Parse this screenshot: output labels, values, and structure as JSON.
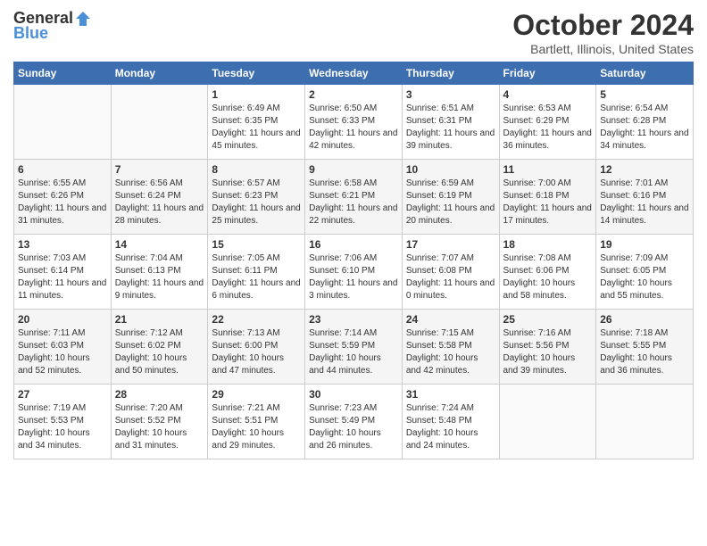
{
  "logo": {
    "general": "General",
    "blue": "Blue"
  },
  "header": {
    "month": "October 2024",
    "location": "Bartlett, Illinois, United States"
  },
  "weekdays": [
    "Sunday",
    "Monday",
    "Tuesday",
    "Wednesday",
    "Thursday",
    "Friday",
    "Saturday"
  ],
  "weeks": [
    [
      {
        "day": "",
        "sunrise": "",
        "sunset": "",
        "daylight": ""
      },
      {
        "day": "",
        "sunrise": "",
        "sunset": "",
        "daylight": ""
      },
      {
        "day": "1",
        "sunrise": "Sunrise: 6:49 AM",
        "sunset": "Sunset: 6:35 PM",
        "daylight": "Daylight: 11 hours and 45 minutes."
      },
      {
        "day": "2",
        "sunrise": "Sunrise: 6:50 AM",
        "sunset": "Sunset: 6:33 PM",
        "daylight": "Daylight: 11 hours and 42 minutes."
      },
      {
        "day": "3",
        "sunrise": "Sunrise: 6:51 AM",
        "sunset": "Sunset: 6:31 PM",
        "daylight": "Daylight: 11 hours and 39 minutes."
      },
      {
        "day": "4",
        "sunrise": "Sunrise: 6:53 AM",
        "sunset": "Sunset: 6:29 PM",
        "daylight": "Daylight: 11 hours and 36 minutes."
      },
      {
        "day": "5",
        "sunrise": "Sunrise: 6:54 AM",
        "sunset": "Sunset: 6:28 PM",
        "daylight": "Daylight: 11 hours and 34 minutes."
      }
    ],
    [
      {
        "day": "6",
        "sunrise": "Sunrise: 6:55 AM",
        "sunset": "Sunset: 6:26 PM",
        "daylight": "Daylight: 11 hours and 31 minutes."
      },
      {
        "day": "7",
        "sunrise": "Sunrise: 6:56 AM",
        "sunset": "Sunset: 6:24 PM",
        "daylight": "Daylight: 11 hours and 28 minutes."
      },
      {
        "day": "8",
        "sunrise": "Sunrise: 6:57 AM",
        "sunset": "Sunset: 6:23 PM",
        "daylight": "Daylight: 11 hours and 25 minutes."
      },
      {
        "day": "9",
        "sunrise": "Sunrise: 6:58 AM",
        "sunset": "Sunset: 6:21 PM",
        "daylight": "Daylight: 11 hours and 22 minutes."
      },
      {
        "day": "10",
        "sunrise": "Sunrise: 6:59 AM",
        "sunset": "Sunset: 6:19 PM",
        "daylight": "Daylight: 11 hours and 20 minutes."
      },
      {
        "day": "11",
        "sunrise": "Sunrise: 7:00 AM",
        "sunset": "Sunset: 6:18 PM",
        "daylight": "Daylight: 11 hours and 17 minutes."
      },
      {
        "day": "12",
        "sunrise": "Sunrise: 7:01 AM",
        "sunset": "Sunset: 6:16 PM",
        "daylight": "Daylight: 11 hours and 14 minutes."
      }
    ],
    [
      {
        "day": "13",
        "sunrise": "Sunrise: 7:03 AM",
        "sunset": "Sunset: 6:14 PM",
        "daylight": "Daylight: 11 hours and 11 minutes."
      },
      {
        "day": "14",
        "sunrise": "Sunrise: 7:04 AM",
        "sunset": "Sunset: 6:13 PM",
        "daylight": "Daylight: 11 hours and 9 minutes."
      },
      {
        "day": "15",
        "sunrise": "Sunrise: 7:05 AM",
        "sunset": "Sunset: 6:11 PM",
        "daylight": "Daylight: 11 hours and 6 minutes."
      },
      {
        "day": "16",
        "sunrise": "Sunrise: 7:06 AM",
        "sunset": "Sunset: 6:10 PM",
        "daylight": "Daylight: 11 hours and 3 minutes."
      },
      {
        "day": "17",
        "sunrise": "Sunrise: 7:07 AM",
        "sunset": "Sunset: 6:08 PM",
        "daylight": "Daylight: 11 hours and 0 minutes."
      },
      {
        "day": "18",
        "sunrise": "Sunrise: 7:08 AM",
        "sunset": "Sunset: 6:06 PM",
        "daylight": "Daylight: 10 hours and 58 minutes."
      },
      {
        "day": "19",
        "sunrise": "Sunrise: 7:09 AM",
        "sunset": "Sunset: 6:05 PM",
        "daylight": "Daylight: 10 hours and 55 minutes."
      }
    ],
    [
      {
        "day": "20",
        "sunrise": "Sunrise: 7:11 AM",
        "sunset": "Sunset: 6:03 PM",
        "daylight": "Daylight: 10 hours and 52 minutes."
      },
      {
        "day": "21",
        "sunrise": "Sunrise: 7:12 AM",
        "sunset": "Sunset: 6:02 PM",
        "daylight": "Daylight: 10 hours and 50 minutes."
      },
      {
        "day": "22",
        "sunrise": "Sunrise: 7:13 AM",
        "sunset": "Sunset: 6:00 PM",
        "daylight": "Daylight: 10 hours and 47 minutes."
      },
      {
        "day": "23",
        "sunrise": "Sunrise: 7:14 AM",
        "sunset": "Sunset: 5:59 PM",
        "daylight": "Daylight: 10 hours and 44 minutes."
      },
      {
        "day": "24",
        "sunrise": "Sunrise: 7:15 AM",
        "sunset": "Sunset: 5:58 PM",
        "daylight": "Daylight: 10 hours and 42 minutes."
      },
      {
        "day": "25",
        "sunrise": "Sunrise: 7:16 AM",
        "sunset": "Sunset: 5:56 PM",
        "daylight": "Daylight: 10 hours and 39 minutes."
      },
      {
        "day": "26",
        "sunrise": "Sunrise: 7:18 AM",
        "sunset": "Sunset: 5:55 PM",
        "daylight": "Daylight: 10 hours and 36 minutes."
      }
    ],
    [
      {
        "day": "27",
        "sunrise": "Sunrise: 7:19 AM",
        "sunset": "Sunset: 5:53 PM",
        "daylight": "Daylight: 10 hours and 34 minutes."
      },
      {
        "day": "28",
        "sunrise": "Sunrise: 7:20 AM",
        "sunset": "Sunset: 5:52 PM",
        "daylight": "Daylight: 10 hours and 31 minutes."
      },
      {
        "day": "29",
        "sunrise": "Sunrise: 7:21 AM",
        "sunset": "Sunset: 5:51 PM",
        "daylight": "Daylight: 10 hours and 29 minutes."
      },
      {
        "day": "30",
        "sunrise": "Sunrise: 7:23 AM",
        "sunset": "Sunset: 5:49 PM",
        "daylight": "Daylight: 10 hours and 26 minutes."
      },
      {
        "day": "31",
        "sunrise": "Sunrise: 7:24 AM",
        "sunset": "Sunset: 5:48 PM",
        "daylight": "Daylight: 10 hours and 24 minutes."
      },
      {
        "day": "",
        "sunrise": "",
        "sunset": "",
        "daylight": ""
      },
      {
        "day": "",
        "sunrise": "",
        "sunset": "",
        "daylight": ""
      }
    ]
  ]
}
